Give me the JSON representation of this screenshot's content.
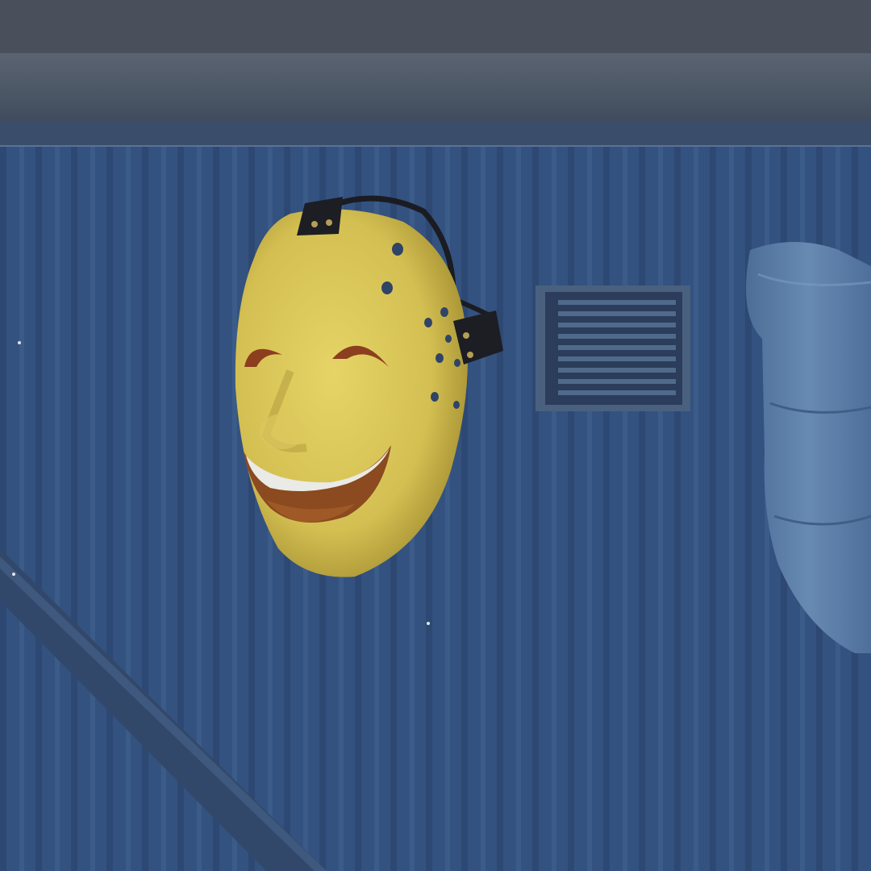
{
  "scene": {
    "subject": "smiling-hockey-mask-item",
    "colors": {
      "wall": "#34527f",
      "wall_shadow": "#2a4066",
      "beam": "#4a5564",
      "mask": "#d9c556",
      "mask_shade": "#b9a23f",
      "mouth": "#8c4a1e",
      "teeth": "#e9e9e4",
      "strap": "#1c1e24",
      "vent": "#3c5478",
      "duct": "#5b7da6"
    },
    "objects": [
      "ceiling-beam",
      "corrugated-wall",
      "wall-vent",
      "pipe",
      "duct-tube",
      "mask"
    ]
  }
}
